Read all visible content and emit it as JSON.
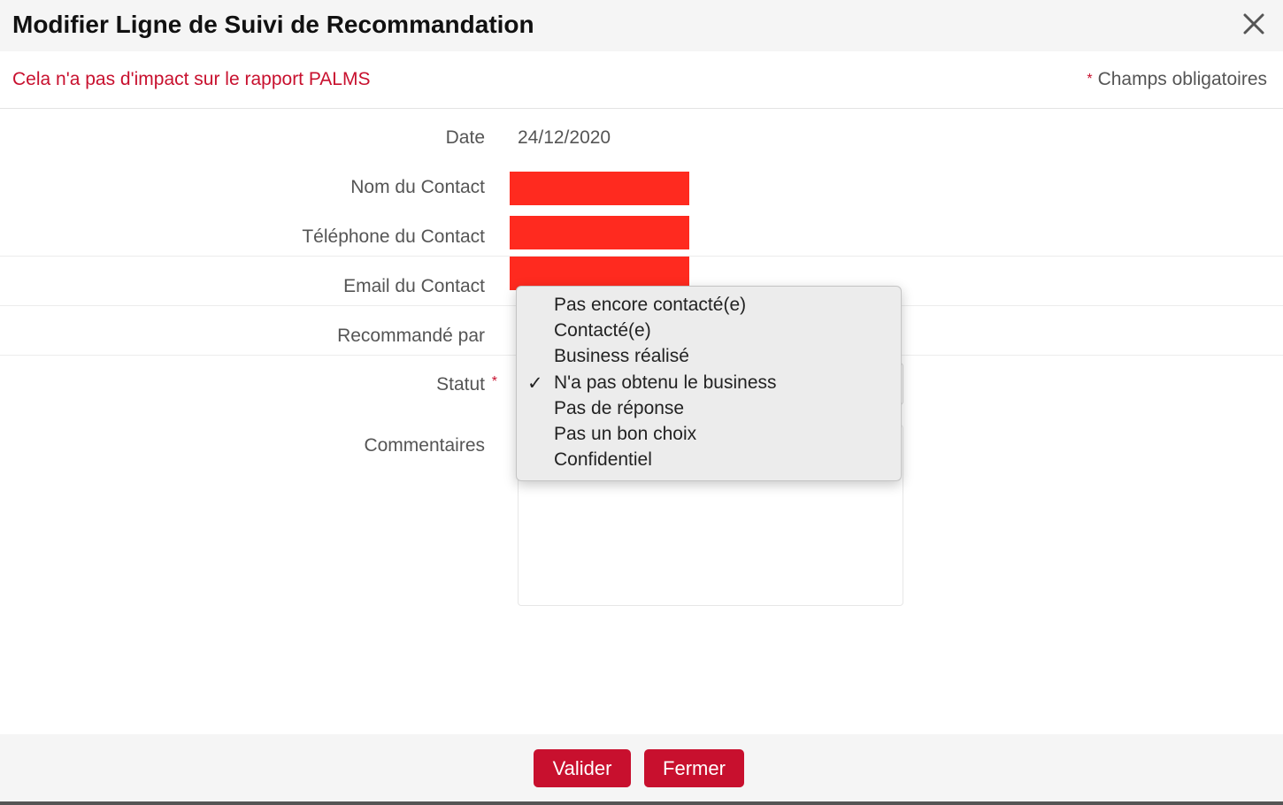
{
  "dialog": {
    "title": "Modifier Ligne de Suivi de Recommandation",
    "close_icon": "close-icon"
  },
  "subheader": {
    "notice": "Cela n'a pas d'impact sur le rapport PALMS",
    "required_star": "*",
    "required_note": "Champs obligatoires"
  },
  "form": {
    "date_label": "Date",
    "date_value": "24/12/2020",
    "contact_name_label": "Nom du Contact",
    "contact_phone_label": "Téléphone du Contact",
    "contact_email_label": "Email du Contact",
    "referred_by_label": "Recommandé par",
    "status_label": "Statut",
    "status_required_star": "*",
    "comments_label": "Commentaires",
    "redaction_color": "#ff2a1f"
  },
  "status_dropdown": {
    "check_mark": "✓",
    "selected_index": 3,
    "options": [
      "Pas encore contacté(e)",
      "Contacté(e)",
      "Business réalisé",
      "N'a pas obtenu le business",
      "Pas de réponse",
      "Pas un bon choix",
      "Confidentiel"
    ]
  },
  "footer": {
    "submit_label": "Valider",
    "close_label": "Fermer"
  },
  "colors": {
    "accent": "#c8102e",
    "header_bg": "#f5f5f5",
    "text": "#555555"
  }
}
